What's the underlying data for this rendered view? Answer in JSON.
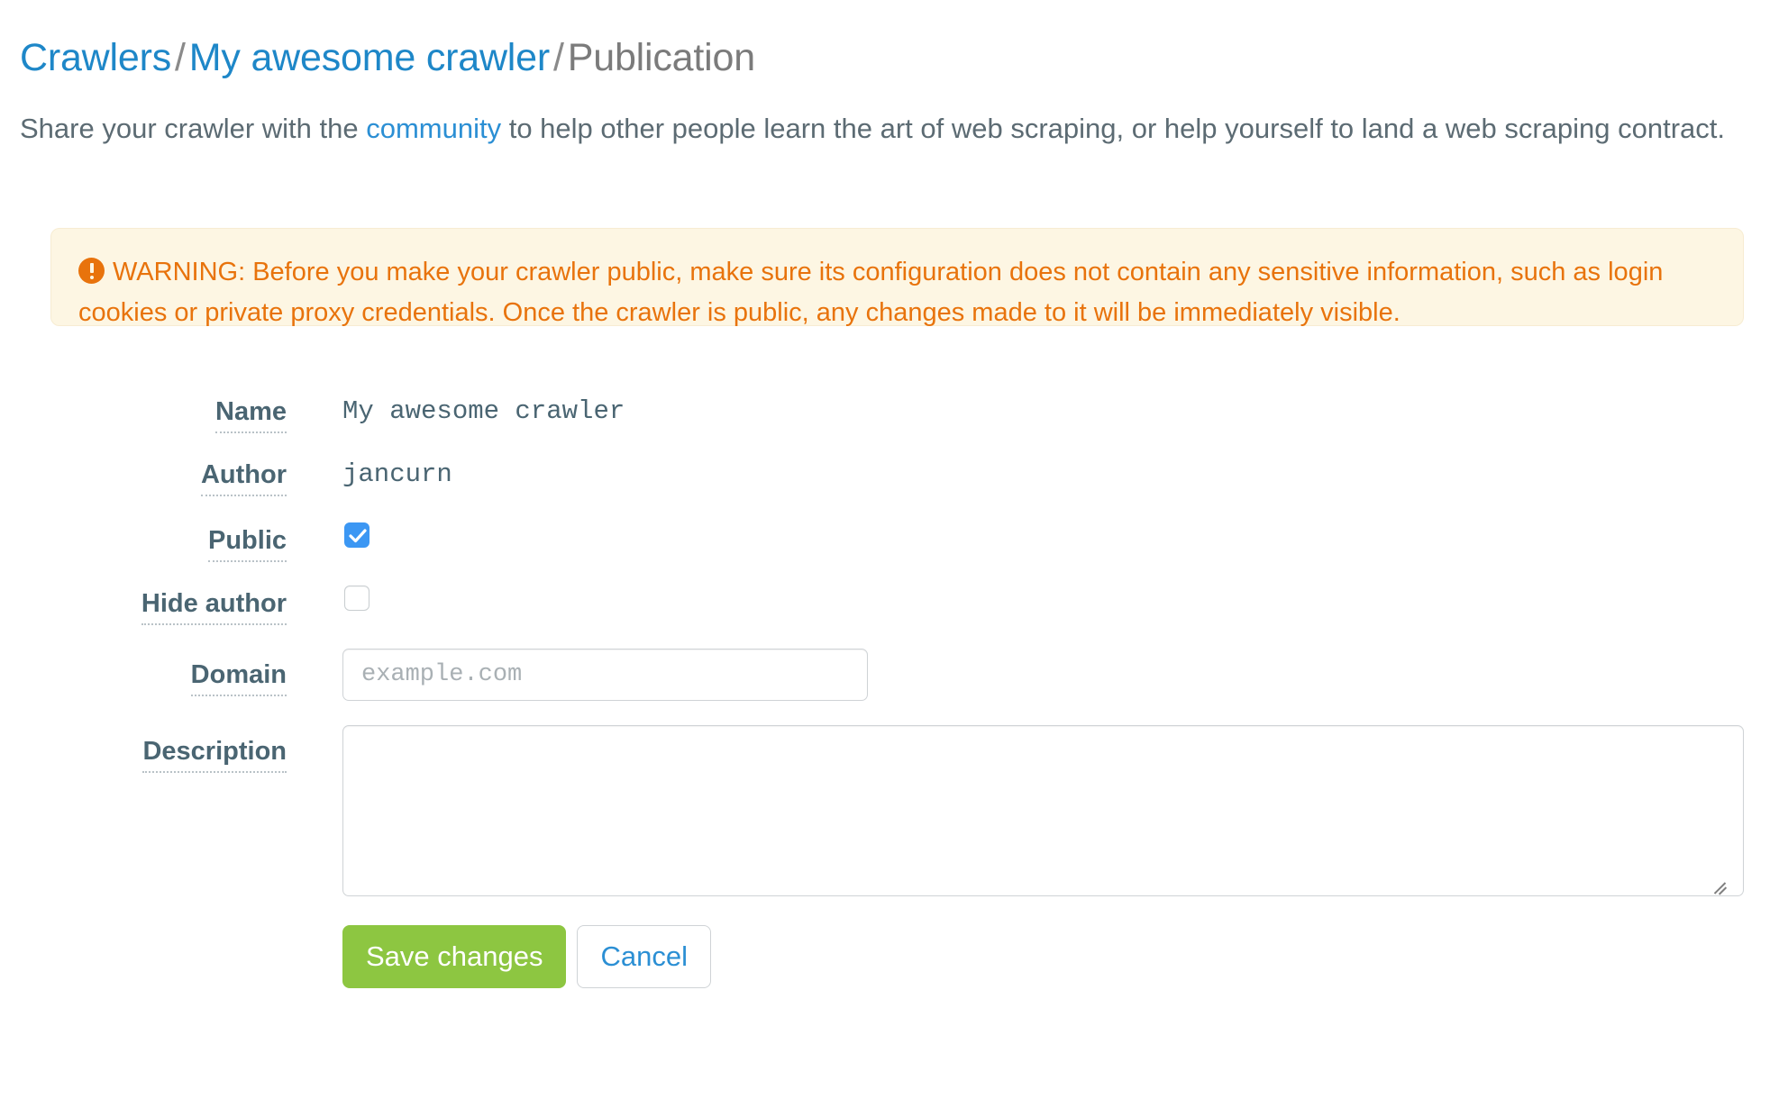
{
  "breadcrumb": {
    "crawlers": "Crawlers",
    "separator": "/",
    "crawler_name": "My awesome crawler",
    "current": "Publication"
  },
  "intro": {
    "part1": "Share your crawler with the ",
    "link": "community",
    "part2": " to help other people learn the art of web scraping, or help yourself to land a web scraping contract."
  },
  "warning": {
    "icon": "exclamation-circle-icon",
    "text": "WARNING: Before you make your crawler public, make sure its configuration does not contain any sensitive information, such as login cookies or private proxy credentials. Once the crawler is public, any changes made to it will be immediately visible.",
    "text_color": "#e8730c",
    "background": "#fdf6e3"
  },
  "form": {
    "name": {
      "label": "Name",
      "value": "My awesome crawler"
    },
    "author": {
      "label": "Author",
      "value": "jancurn"
    },
    "public": {
      "label": "Public",
      "checked": "true"
    },
    "hide_author": {
      "label": "Hide author",
      "checked": "false"
    },
    "domain": {
      "label": "Domain",
      "value": "",
      "placeholder": "example.com"
    },
    "description": {
      "label": "Description",
      "value": "",
      "placeholder": ""
    }
  },
  "actions": {
    "save_label": "Save changes",
    "cancel_label": "Cancel",
    "save_color": "#8dc641",
    "cancel_color": "#2b8fd4"
  }
}
